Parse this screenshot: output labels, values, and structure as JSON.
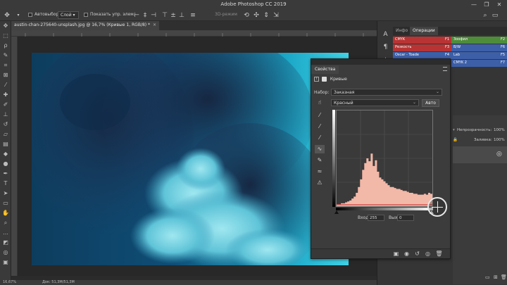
{
  "app": {
    "title": "Adobe Photoshop CC 2019"
  },
  "window_controls": [
    "—",
    "❐",
    "✕"
  ],
  "options_bar": {
    "autoselect_label": "Автовыбор:",
    "autoselect_value": "Слой",
    "show_transform_label": "Показать упр. элем.",
    "mode_3d_label": "3D-режим"
  },
  "document": {
    "tab_label": "austin-chan-275640-unsplash.jpg @ 16,7% (Кривые 1, RGB/8) *",
    "zoom": "16,67%",
    "doc_info": "Док: 51,3M/51,3M"
  },
  "right_panel": {
    "tabs": [
      "Инфо",
      "Операции"
    ],
    "actions_left": [
      {
        "label": "CMYK",
        "key": "F1",
        "color": "#b83333"
      },
      {
        "label": "Резкость",
        "key": "F3",
        "color": "#b83333"
      },
      {
        "label": "Oscar - Toade",
        "key": "F4",
        "color": "#3d5fa8"
      }
    ],
    "actions_right": [
      {
        "label": "Зоофил",
        "key": "F2",
        "color": "#4e8c3a"
      },
      {
        "label": "B/W",
        "key": "F6",
        "color": "#3d5fa8"
      },
      {
        "label": "Lab",
        "key": "F5",
        "color": "#3d5fa8"
      },
      {
        "label": "CMYK 2",
        "key": "F7",
        "color": "#3d5fa8"
      }
    ],
    "layers": {
      "opacity_label": "Непрозрачность:",
      "opacity_value": "100%",
      "fill_label": "Заливка:",
      "fill_value": "100%"
    }
  },
  "properties": {
    "title": "Свойства",
    "adjustment_name": "Кривые",
    "preset_label": "Набор:",
    "preset_value": "Заказная",
    "channel_value": "Красный",
    "auto_label": "Авто",
    "input_label": "Вход:",
    "input_value": "255",
    "output_label": "Выход:",
    "output_value": "0"
  },
  "histogram": {
    "values": [
      0.02,
      0.02,
      0.03,
      0.03,
      0.04,
      0.05,
      0.06,
      0.08,
      0.1,
      0.14,
      0.2,
      0.28,
      0.38,
      0.45,
      0.5,
      0.47,
      0.55,
      0.42,
      0.48,
      0.36,
      0.3,
      0.28,
      0.26,
      0.24,
      0.22,
      0.2,
      0.2,
      0.19,
      0.18,
      0.18,
      0.17,
      0.16,
      0.16,
      0.15,
      0.14,
      0.14,
      0.13,
      0.13,
      0.12,
      0.12,
      0.12,
      0.13,
      0.12,
      0.14,
      0.13
    ],
    "fill_color": "#f2b8a8"
  }
}
